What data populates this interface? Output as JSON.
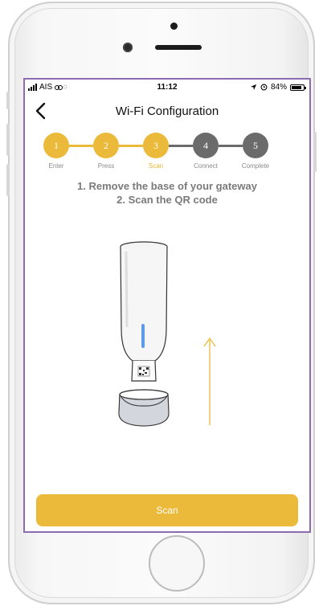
{
  "status_bar": {
    "carrier": "AIS",
    "time": "11:12",
    "battery_text": "84%",
    "battery_level": 0.84
  },
  "nav": {
    "title": "Wi-Fi Configuration"
  },
  "stepper": {
    "steps": [
      {
        "number": "1",
        "label": "Enter",
        "state": "done"
      },
      {
        "number": "2",
        "label": "Press",
        "state": "done"
      },
      {
        "number": "3",
        "label": "Scan",
        "state": "active"
      },
      {
        "number": "4",
        "label": "Connect",
        "state": "pending"
      },
      {
        "number": "5",
        "label": "Complete",
        "state": "pending"
      }
    ]
  },
  "instructions": {
    "line1": "1. Remove the base of your gateway",
    "line2": "2. Scan the QR code"
  },
  "actions": {
    "scan_label": "Scan"
  },
  "colors": {
    "accent": "#ecba3a",
    "pending_step": "#6b6b6b",
    "active_label": "#e9b535",
    "led": "#5d9be8",
    "base_fill": "#d3d6dc",
    "frame_border": "#8a6cb3"
  },
  "icons": {
    "back": "chevron-left-icon",
    "location": "location-arrow-icon",
    "signal": "signal-bars-icon",
    "battery": "battery-icon"
  }
}
